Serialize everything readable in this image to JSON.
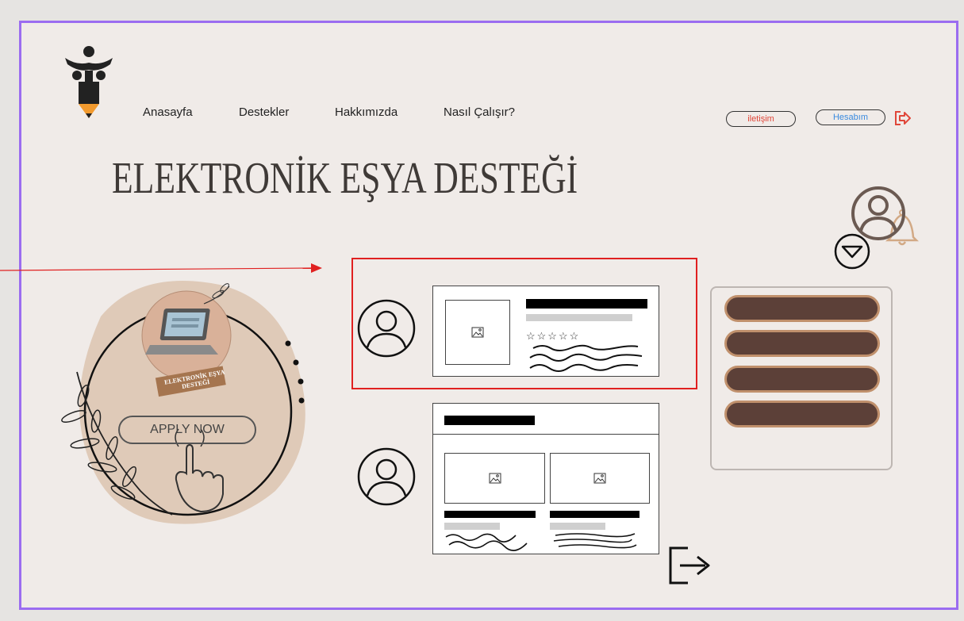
{
  "nav": {
    "items": [
      "Anasayfa",
      "Destekler",
      "Hakkımızda",
      "Nasıl Çalışır?"
    ]
  },
  "header": {
    "contact_label": "iletişim",
    "account_label": "Hesabım"
  },
  "page": {
    "title": "ELEKTRONİK EŞYA DESTEĞİ"
  },
  "promo": {
    "badge_label": "ELEKTRONİK EŞYA DESTEĞİ",
    "apply_label": "APPLY NOW"
  },
  "card1": {
    "stars": "☆☆☆☆☆"
  },
  "colors": {
    "frame_border": "#9b6cf0",
    "background": "#f0ebe8",
    "contact_text": "#e0473a",
    "account_text": "#3a8be0",
    "logout_icon": "#e0473a",
    "highlight_border": "#e02020",
    "menu_pill_fill": "#5c4038",
    "menu_pill_border": "#c0906c"
  }
}
